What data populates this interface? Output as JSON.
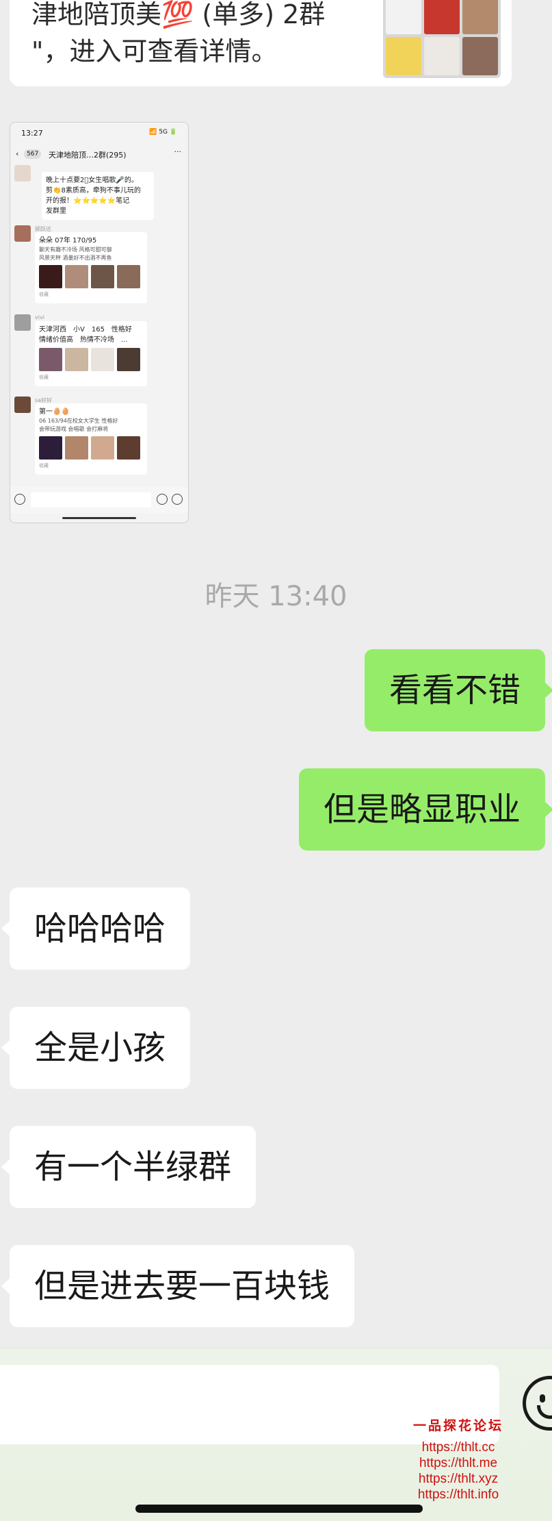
{
  "shared_card": {
    "title": "津地陪顶美💯 (单多) 2群",
    "description": "\"，进入可查看详情。",
    "thumb_colors": [
      "#f2f2f2",
      "#c8372d",
      "#b48a6c",
      "#f2d35a",
      "#ece8e4",
      "#8c6b5c"
    ]
  },
  "screenshot_message": {
    "time": "13:27",
    "signal": "📶 5G 🔋",
    "back_badge": "567",
    "group_name": "天津地陪顶…2群(295)",
    "posts": [
      {
        "name": "",
        "line1": "晚上十点要2⃣女生唱歌🎤的。",
        "line2": "剪👏8素质高，牵狗不事儿玩的",
        "line3": "开的报！⭐⭐⭐⭐⭐笔记",
        "line4": "发群里",
        "pics": 0,
        "fav": ""
      },
      {
        "name": "顾跃达",
        "line1": "朵朵 07年 170/95",
        "line2": "聊天有趣不冷场 风格可甜可御",
        "line3": "风景天秤 酒量好不出酒不再鱼",
        "line4": "",
        "pics": 4,
        "fav": "收藏"
      },
      {
        "name": "vivi",
        "line1": "天津河西　小V　165　性格好",
        "line2": "情绪价值高　热情不冷场　...",
        "line3": "",
        "line4": "",
        "pics": 4,
        "fav": "收藏"
      },
      {
        "name": "sa好好",
        "line1": "第一🥚🥚",
        "line2": "06 163/94在校女大学生 性格好",
        "line3": "会带玩游戏 会唱歌 会打麻将",
        "line4": "",
        "pics": 3,
        "fav": "收藏"
      }
    ]
  },
  "timestamp": "昨天 13:40",
  "messages": [
    {
      "side": "right",
      "text": "看看不错"
    },
    {
      "side": "right",
      "text": "但是略显职业"
    },
    {
      "side": "left",
      "text": "哈哈哈哈"
    },
    {
      "side": "left",
      "text": "全是小孩"
    },
    {
      "side": "left",
      "text": "有一个半绿群"
    },
    {
      "side": "left",
      "text": "但是进去要一百块钱"
    }
  ],
  "input": {
    "value": "",
    "emoji_icon": "smiley-icon"
  },
  "watermark": {
    "title": "一品探花论坛",
    "links": [
      "https://thlt.cc",
      "https://thlt.me",
      "https://thlt.xyz",
      "https://thlt.info"
    ]
  },
  "colors": {
    "background": "#ededed",
    "sent_bubble": "#95ec69",
    "received_bubble": "#ffffff",
    "watermark": "#d01010",
    "timestamp": "#a9a9a9"
  }
}
